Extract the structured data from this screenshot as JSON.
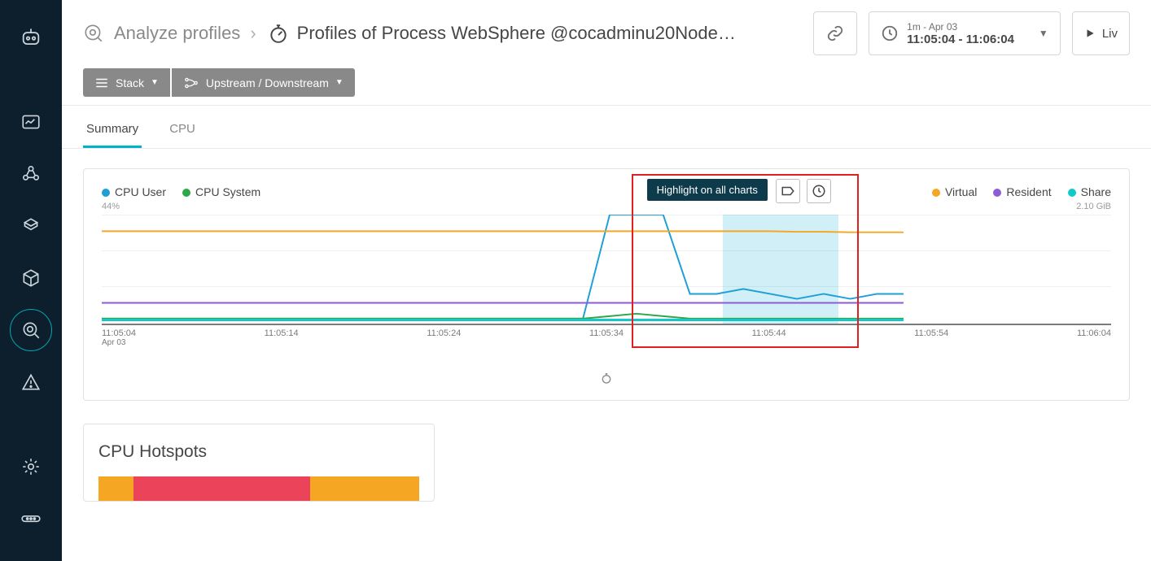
{
  "breadcrumb": {
    "label": "Analyze profiles"
  },
  "page_title": "Profiles of Process WebSphere @cocadminu20Node…",
  "timepicker": {
    "top": "1m - Apr 03",
    "range": "11:05:04 - 11:06:04"
  },
  "live_label": "Liv",
  "toolbar": {
    "stack": "Stack",
    "updown": "Upstream / Downstream"
  },
  "tabs": {
    "summary": "Summary",
    "cpu": "CPU"
  },
  "chart_legend": {
    "left": [
      {
        "name": "CPU User",
        "color": "#1f9fd6"
      },
      {
        "name": "CPU System",
        "color": "#2aa84a"
      }
    ],
    "right": [
      {
        "name": "Virtual",
        "color": "#f5a623"
      },
      {
        "name": "Resident",
        "color": "#8e5bd6"
      },
      {
        "name": "Share",
        "color": "#14c8c8"
      }
    ],
    "ymax_left": "44%",
    "ymax_right": "2.10 GiB"
  },
  "chart_data": {
    "type": "line",
    "xlabel": "",
    "ylabel": "",
    "x_ticks": [
      "11:05:04",
      "11:05:14",
      "11:05:24",
      "11:05:34",
      "11:05:44",
      "11:05:54",
      "11:06:04"
    ],
    "x_sub": "Apr 03",
    "ylim_left": [
      0,
      44
    ],
    "ylim_right": [
      0,
      2.1
    ],
    "highlight_range": [
      "11:05:42",
      "11:05:48"
    ],
    "series": [
      {
        "name": "CPU User",
        "axis": "left",
        "color": "#1f9fd6",
        "values": [
          2,
          2,
          2,
          2,
          2,
          2,
          2,
          2,
          2,
          2,
          2,
          2,
          2,
          2,
          2,
          2,
          2,
          2,
          2,
          44,
          44,
          44,
          12,
          12,
          14,
          12,
          10,
          12,
          10,
          12,
          12
        ]
      },
      {
        "name": "CPU System",
        "axis": "left",
        "color": "#2aa84a",
        "values": [
          2,
          2,
          2,
          2,
          2,
          2,
          2,
          2,
          2,
          2,
          2,
          2,
          2,
          2,
          2,
          2,
          2,
          2,
          2,
          3,
          4,
          3,
          2,
          2,
          2,
          2,
          2,
          2,
          2,
          2,
          2
        ]
      },
      {
        "name": "Virtual",
        "axis": "right",
        "color": "#f5a623",
        "values": [
          1.78,
          1.78,
          1.78,
          1.78,
          1.78,
          1.78,
          1.78,
          1.78,
          1.78,
          1.78,
          1.78,
          1.78,
          1.78,
          1.78,
          1.78,
          1.78,
          1.78,
          1.78,
          1.78,
          1.78,
          1.78,
          1.78,
          1.78,
          1.78,
          1.78,
          1.78,
          1.77,
          1.77,
          1.76,
          1.76,
          1.76
        ]
      },
      {
        "name": "Resident",
        "axis": "right",
        "color": "#8e5bd6",
        "values": [
          0.4,
          0.4,
          0.4,
          0.4,
          0.4,
          0.4,
          0.4,
          0.4,
          0.4,
          0.4,
          0.4,
          0.4,
          0.4,
          0.4,
          0.4,
          0.4,
          0.4,
          0.4,
          0.4,
          0.4,
          0.4,
          0.4,
          0.4,
          0.4,
          0.4,
          0.4,
          0.4,
          0.4,
          0.4,
          0.4,
          0.4
        ]
      },
      {
        "name": "Share",
        "axis": "right",
        "color": "#14c8c8",
        "values": [
          0.07,
          0.07,
          0.07,
          0.07,
          0.07,
          0.07,
          0.07,
          0.07,
          0.07,
          0.07,
          0.07,
          0.07,
          0.07,
          0.07,
          0.07,
          0.07,
          0.07,
          0.07,
          0.07,
          0.07,
          0.07,
          0.07,
          0.07,
          0.07,
          0.07,
          0.07,
          0.07,
          0.07,
          0.07,
          0.07,
          0.07
        ]
      }
    ]
  },
  "tooltip": "Highlight on all charts",
  "hotspots": {
    "title": "CPU Hotspots",
    "segments": [
      {
        "color": "#f5a623",
        "pct": 11
      },
      {
        "color": "#eb445a",
        "pct": 55
      },
      {
        "color": "#f5a623",
        "pct": 34
      }
    ]
  }
}
